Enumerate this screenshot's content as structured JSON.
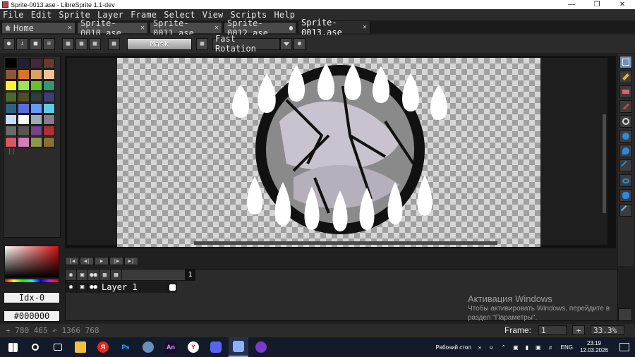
{
  "window": {
    "title": "Sprite-0013.ase - LibreSprite 1.1-dev"
  },
  "menu": [
    "File",
    "Edit",
    "Sprite",
    "Layer",
    "Frame",
    "Select",
    "View",
    "Scripts",
    "Help"
  ],
  "tabs": [
    {
      "label": "Home",
      "state": "close"
    },
    {
      "label": "Sprite-0010.ase",
      "state": "close"
    },
    {
      "label": "Sprite-0011.ase",
      "state": "close"
    },
    {
      "label": "Sprite-0012.ase",
      "state": "modified"
    },
    {
      "label": "Sprite-0013.ase",
      "state": "active"
    }
  ],
  "context_bar": {
    "mask_label": "Mask",
    "rotation_algorithm": "Fast Rotation"
  },
  "palette": [
    "#000000",
    "#222034",
    "#45283c",
    "#663931",
    "#8f563b",
    "#df7126",
    "#d9a066",
    "#eec39a",
    "#fbf236",
    "#99e550",
    "#6abe30",
    "#37946e",
    "#4b692f",
    "#524b24",
    "#323c39",
    "#3f3f74",
    "#306082",
    "#5b6ee1",
    "#639bff",
    "#5fcde4",
    "#cbdbfc",
    "#ffffff",
    "#9badb7",
    "#847e87",
    "#696a6a",
    "#595652",
    "#76428a",
    "#ac3232",
    "#d95763",
    "#d77bba",
    "#8f974a",
    "#8a6f30"
  ],
  "color": {
    "index_label": "Idx-0",
    "hex_label": "#000000"
  },
  "timeline": {
    "frame_number": "1",
    "layer_name": "Layer 1"
  },
  "activation": {
    "title": "Активация Windows",
    "line1": "Чтобы активировать Windows, перейдите в",
    "line2": "раздел \"Параметры\"."
  },
  "status": {
    "coords": "780 465",
    "size": "1366 768",
    "frame_label": "Frame:",
    "frame_value": "1",
    "zoom": "33.3%"
  },
  "taskbar": {
    "desktop_label": "Рабочий стол",
    "lang": "ENG",
    "time": "23:19",
    "date": "12.03.2026"
  }
}
